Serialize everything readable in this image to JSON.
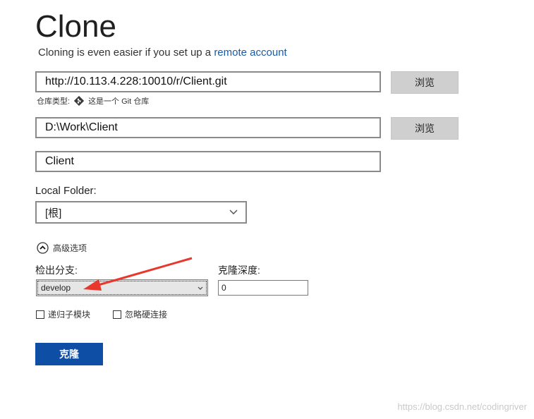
{
  "page": {
    "title": "Clone",
    "subtitle_prefix": "Cloning is even easier if you set up a ",
    "subtitle_link": "remote account"
  },
  "url": {
    "value": "http://10.113.4.228:10010/r/Client.git",
    "browse_label": "浏览",
    "repo_type_label": "仓库类型:",
    "repo_type_value": "这是一个 Git 仓库"
  },
  "path": {
    "value": "D:\\Work\\Client",
    "browse_label": "浏览"
  },
  "name": {
    "value": "Client"
  },
  "local_folder": {
    "label": "Local Folder:",
    "selected": "[根]"
  },
  "advanced": {
    "toggle_label": "高级选项",
    "branch_label": "检出分支:",
    "branch_value": "develop",
    "depth_label": "克隆深度:",
    "depth_value": "0",
    "recursive_label": "递归子模块",
    "ignore_label": "忽略硬连接"
  },
  "actions": {
    "clone_label": "克隆"
  },
  "watermark": "https://blog.csdn.net/codingriver",
  "colors": {
    "accent": "#0f4ea5",
    "link": "#1a5aa6",
    "arrow": "#e8372d"
  }
}
